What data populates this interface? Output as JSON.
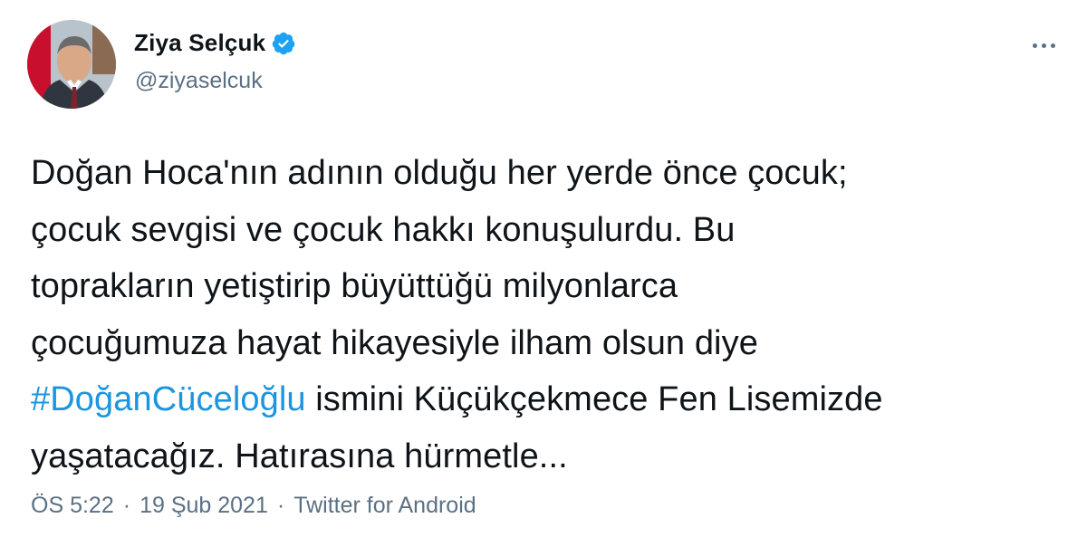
{
  "author": {
    "display_name": "Ziya Selçuk",
    "handle": "@ziyaselcuk",
    "verified_icon": "verified-badge-icon",
    "accent": "#1da1f2"
  },
  "menu": {
    "icon": "more-horizontal-icon"
  },
  "tweet": {
    "lines": [
      "Doğan Hoca'nın adının olduğu her yerde önce çocuk;",
      "çocuk sevgisi ve çocuk hakkı konuşulurdu. Bu",
      "toprakların yetiştirip büyüttüğü milyonlarca",
      "çocuğumuza hayat hikayesiyle ilham olsun diye"
    ],
    "hashtag": "#DoğanCüceloğlu",
    "line5_rest": " ismini Küçükçekmece Fen Lisemizde",
    "line6": "yaşatacağız. Hatırasına hürmetle..."
  },
  "meta": {
    "time": "ÖS 5:22",
    "separator": "·",
    "date": "19 Şub 2021",
    "source": "Twitter for Android"
  },
  "colors": {
    "text": "#0f1419",
    "secondary": "#5b7083",
    "link": "#1b95e0"
  }
}
